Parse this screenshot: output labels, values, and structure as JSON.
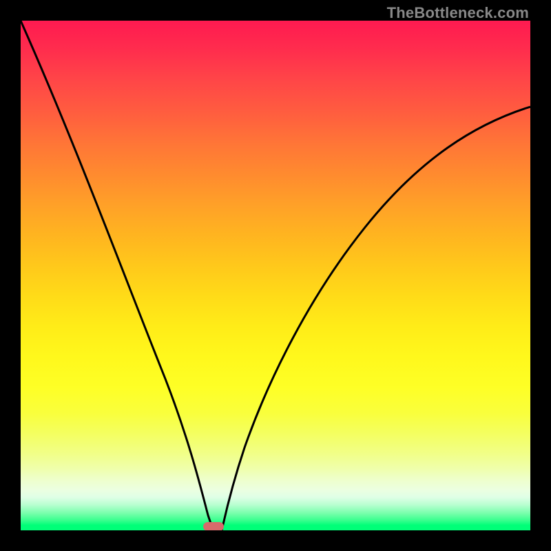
{
  "watermark": "TheBottleneck.com",
  "chart_data": {
    "type": "line",
    "title": "",
    "xlabel": "",
    "ylabel": "",
    "xlim": [
      0,
      1
    ],
    "ylim": [
      0,
      1
    ],
    "gradient_stops": [
      {
        "pos": 0.0,
        "color": "#ff1a50"
      },
      {
        "pos": 0.3,
        "color": "#ff8a2f"
      },
      {
        "pos": 0.6,
        "color": "#ffec18"
      },
      {
        "pos": 0.85,
        "color": "#f1ff88"
      },
      {
        "pos": 0.95,
        "color": "#b8ffd0"
      },
      {
        "pos": 1.0,
        "color": "#00ff78"
      }
    ],
    "series": [
      {
        "name": "left_curve",
        "x": [
          0.0,
          0.05,
          0.1,
          0.15,
          0.2,
          0.25,
          0.3,
          0.335,
          0.36,
          0.375,
          0.378
        ],
        "y": [
          1.0,
          0.87,
          0.745,
          0.625,
          0.505,
          0.385,
          0.265,
          0.16,
          0.075,
          0.02,
          0.0
        ]
      },
      {
        "name": "right_curve",
        "x": [
          0.395,
          0.41,
          0.44,
          0.49,
          0.56,
          0.64,
          0.73,
          0.82,
          0.91,
          1.0
        ],
        "y": [
          0.0,
          0.04,
          0.12,
          0.245,
          0.39,
          0.52,
          0.63,
          0.715,
          0.78,
          0.83
        ]
      }
    ],
    "marker": {
      "x_center": 0.378,
      "y": 0.0,
      "color": "#d66b6b"
    }
  }
}
